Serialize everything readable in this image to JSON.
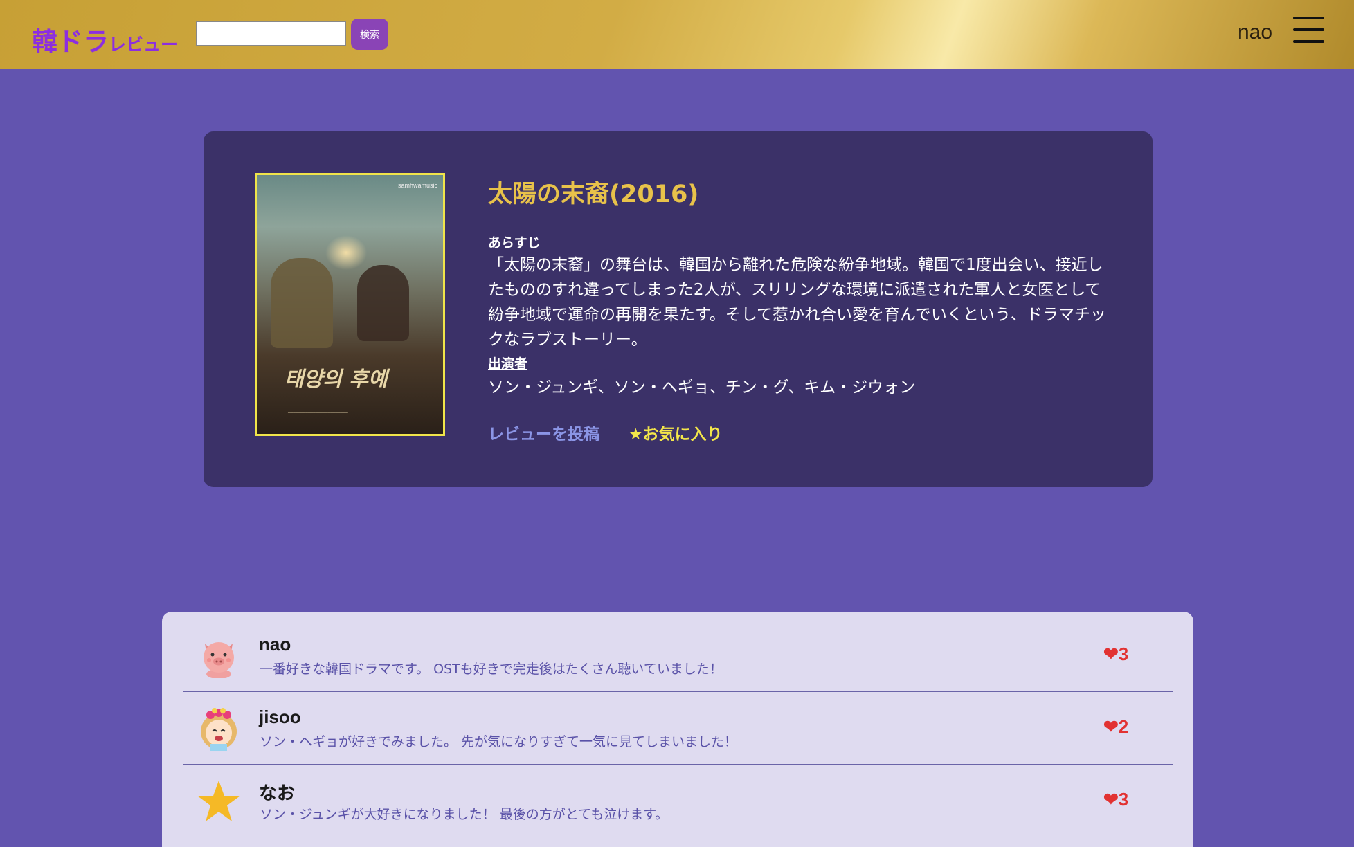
{
  "header": {
    "logo_main": "韓ドラ",
    "logo_sub": "レビュー",
    "search_value": "",
    "search_button": "検索",
    "username": "nao",
    "menu_icon": "hamburger-menu-icon"
  },
  "drama": {
    "title": "太陽の末裔(2016)",
    "poster_alt_text": "태양의 후예",
    "poster_brand": "samhwamusic",
    "synopsis_label": "あらすじ",
    "synopsis": "「太陽の末裔」の舞台は、韓国から離れた危険な紛争地域。韓国で1度出会い、接近したもののすれ違ってしまった2人が、スリリングな環境に派遣された軍人と女医として紛争地域で運命の再開を果たす。そして惹かれ合い愛を育んでいくという、ドラマチックなラブストーリー。",
    "cast_label": "出演者",
    "cast": "ソン・ジュンギ、ソン・ヘギョ、チン・グ、キム・ジウォン",
    "post_review": "レビューを投稿",
    "favorite": "★お気に入り"
  },
  "reviews": [
    {
      "user": "nao",
      "avatar": "pig-avatar-icon",
      "text": "一番好きな韓国ドラマです。 OSTも好きで完走後はたくさん聴いていました！",
      "likes": "3"
    },
    {
      "user": "jisoo",
      "avatar": "girl-avatar-icon",
      "text": "ソン・ヘギョが好きでみました。 先が気になりすぎて一気に見てしまいました！",
      "likes": "2"
    },
    {
      "user": "なお",
      "avatar": "star-avatar-icon",
      "text": "ソン・ジュンギが大好きになりました！ 最後の方がとても泣けます。",
      "likes": "3"
    }
  ],
  "colors": {
    "background": "#6254af",
    "card": "#3b3168",
    "title": "#e8c24a",
    "logo": "#8c2ee0",
    "like": "#e23232"
  }
}
